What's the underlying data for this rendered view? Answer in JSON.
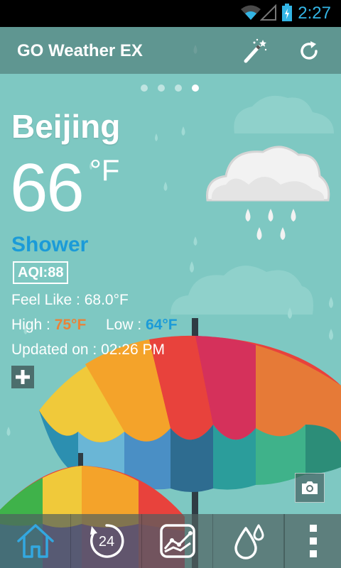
{
  "status_bar": {
    "time": "2:27"
  },
  "app_bar": {
    "title": "GO Weather EX"
  },
  "pager": {
    "count": 4,
    "active_index": 3
  },
  "weather": {
    "city": "Beijing",
    "temperature": "66",
    "unit": "°F",
    "condition": "Shower",
    "aqi": "AQI:88",
    "feel_like": "Feel Like : 68.0°F",
    "high_label": "High :",
    "high_value": "75°F",
    "low_label": "Low :",
    "low_value": "64°F",
    "updated": "Updated on : 02:26 PM"
  },
  "colors": {
    "background": "#7ec8c2",
    "accent_blue": "#1b9bd8",
    "high_orange": "#e8833a",
    "status_blue": "#33b5e5"
  },
  "icons": {
    "wand": "magic-wand-icon",
    "refresh": "refresh-icon",
    "add": "plus-icon",
    "camera": "camera-icon",
    "home": "home-icon",
    "hourly": "24-hour-icon",
    "trend": "trend-chart-icon",
    "precipitation": "droplets-icon",
    "more": "more-vertical-icon"
  },
  "nav": {
    "hourly_label": "24"
  }
}
